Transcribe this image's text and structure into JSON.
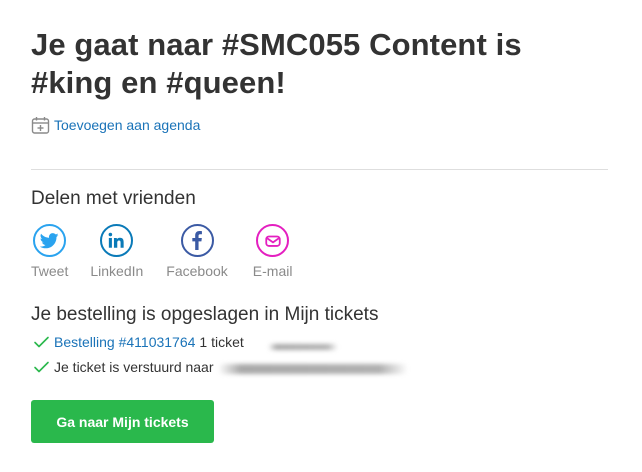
{
  "header": {
    "title": "Je gaat naar #SMC055 Content is #king en #queen!",
    "agenda_link": "Toevoegen aan agenda"
  },
  "share": {
    "heading": "Delen met vrienden",
    "items": [
      {
        "label": "Tweet",
        "icon": "twitter-icon",
        "color": "#2aa3ef"
      },
      {
        "label": "LinkedIn",
        "icon": "linkedin-icon",
        "color": "#0a7ab8"
      },
      {
        "label": "Facebook",
        "icon": "facebook-icon",
        "color": "#3b5aa4"
      },
      {
        "label": "E-mail",
        "icon": "email-icon",
        "color": "#e41fc0"
      }
    ]
  },
  "order": {
    "heading": "Je bestelling is opgeslagen in Mijn tickets",
    "order_link": "Bestelling #411031764",
    "ticket_count": "1 ticket",
    "sent_text": "Je ticket is verstuurd naar"
  },
  "cta": {
    "label": "Ga naar Mijn tickets",
    "color": "#2ab84c"
  },
  "colors": {
    "link": "#1a73b8",
    "check": "#2ab84c",
    "muted": "#8a8a8a"
  }
}
